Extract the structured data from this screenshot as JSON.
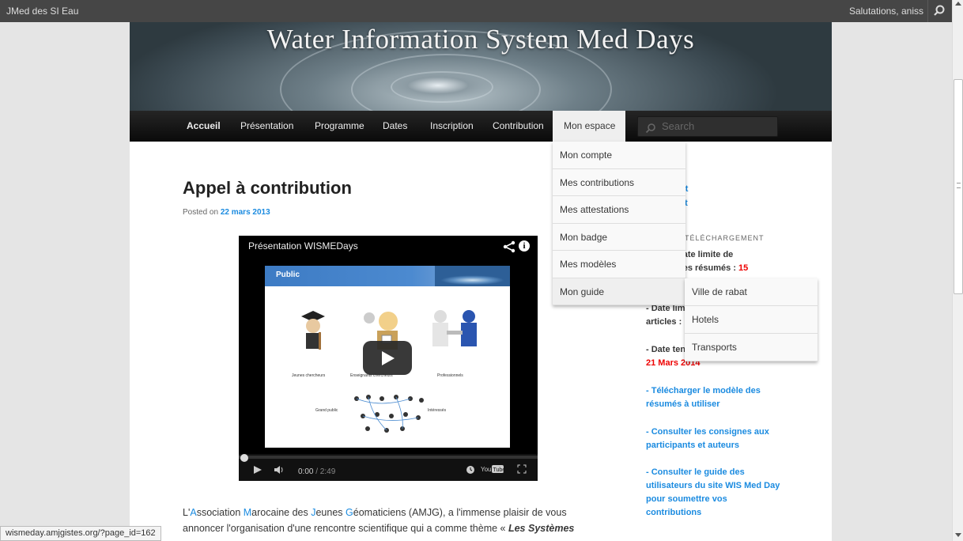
{
  "adminbar": {
    "site_name": "JMed des SI Eau",
    "greeting": "Salutations, aniss"
  },
  "banner": {
    "title": "Water Information System Med Days"
  },
  "nav": {
    "items": [
      "Accueil",
      "Présentation",
      "Programme",
      "Dates",
      "Inscription",
      "Contribution",
      "Mon espace"
    ],
    "search_placeholder": "Search"
  },
  "dropdown": {
    "items": [
      "Mon compte",
      "Mes contributions",
      "Mes attestations",
      "Mon badge",
      "Mes modèles",
      "Mon guide"
    ],
    "sub_items": [
      "Ville de rabat",
      "Hotels",
      "Transports"
    ]
  },
  "post": {
    "title": "Appel à contribution",
    "posted_prefix": "Posted on",
    "date": "22 mars 2013"
  },
  "video": {
    "title": "Présentation WISMEDays",
    "slide_header": "Public",
    "captions": [
      "Jeunes chercheurs",
      "Enseignants chercheurs",
      "Professionnels",
      "Grand public",
      "Intéressés"
    ],
    "time_current": "0:00",
    "time_total": "/ 2:49",
    "progress": 0
  },
  "paragraph": {
    "letters": [
      "A",
      "M",
      "J",
      "G"
    ],
    "parts": [
      "L'",
      "ssociation ",
      "arocaine des ",
      "eunes ",
      "éomaticiens (AMJG), a l'immense plaisir de vous"
    ],
    "line2_prefix": "annoncer l'organisation d'une rencontre scientifique qui a comme thème « ",
    "line2_em": "Les Systèmes"
  },
  "sidebar": {
    "fragment1": "int",
    "fragment2": "iat",
    "heading": "TÉLÉCHARGEMENT",
    "d1a": "date limite de",
    "d1b_prefix": "des résumés : ",
    "d1b_red": "15",
    "d2a": "- Date limi",
    "d2b": "articles : ",
    "d2c": "- Date ten",
    "d2d": "21 Mars 2014",
    "links": [
      [
        "- Télécharger le modèle des",
        "résumés à utiliser"
      ],
      [
        "- Consulter les consignes aux",
        "participants et auteurs"
      ],
      [
        "- Consulter le guide des",
        "utilisateurs du site WIS Med Day",
        "pour soumettre vos",
        "contributions"
      ]
    ]
  },
  "status_url": "wismeday.amjgistes.org/?page_id=162"
}
